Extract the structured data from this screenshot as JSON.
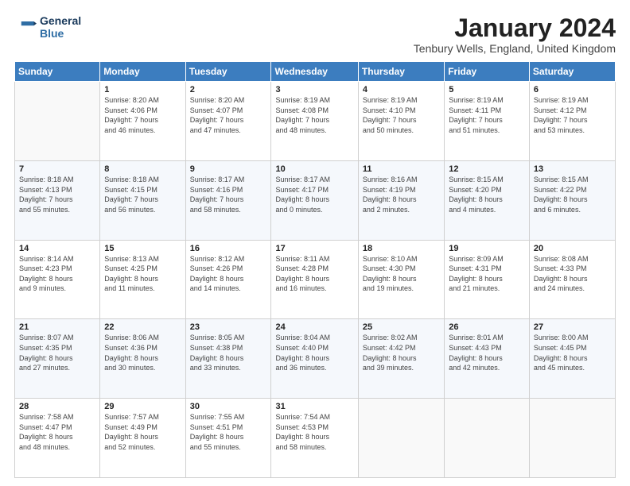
{
  "logo": {
    "line1": "General",
    "line2": "Blue"
  },
  "title": "January 2024",
  "location": "Tenbury Wells, England, United Kingdom",
  "days_header": [
    "Sunday",
    "Monday",
    "Tuesday",
    "Wednesday",
    "Thursday",
    "Friday",
    "Saturday"
  ],
  "weeks": [
    [
      {
        "day": "",
        "detail": ""
      },
      {
        "day": "1",
        "detail": "Sunrise: 8:20 AM\nSunset: 4:06 PM\nDaylight: 7 hours\nand 46 minutes."
      },
      {
        "day": "2",
        "detail": "Sunrise: 8:20 AM\nSunset: 4:07 PM\nDaylight: 7 hours\nand 47 minutes."
      },
      {
        "day": "3",
        "detail": "Sunrise: 8:19 AM\nSunset: 4:08 PM\nDaylight: 7 hours\nand 48 minutes."
      },
      {
        "day": "4",
        "detail": "Sunrise: 8:19 AM\nSunset: 4:10 PM\nDaylight: 7 hours\nand 50 minutes."
      },
      {
        "day": "5",
        "detail": "Sunrise: 8:19 AM\nSunset: 4:11 PM\nDaylight: 7 hours\nand 51 minutes."
      },
      {
        "day": "6",
        "detail": "Sunrise: 8:19 AM\nSunset: 4:12 PM\nDaylight: 7 hours\nand 53 minutes."
      }
    ],
    [
      {
        "day": "7",
        "detail": "Sunrise: 8:18 AM\nSunset: 4:13 PM\nDaylight: 7 hours\nand 55 minutes."
      },
      {
        "day": "8",
        "detail": "Sunrise: 8:18 AM\nSunset: 4:15 PM\nDaylight: 7 hours\nand 56 minutes."
      },
      {
        "day": "9",
        "detail": "Sunrise: 8:17 AM\nSunset: 4:16 PM\nDaylight: 7 hours\nand 58 minutes."
      },
      {
        "day": "10",
        "detail": "Sunrise: 8:17 AM\nSunset: 4:17 PM\nDaylight: 8 hours\nand 0 minutes."
      },
      {
        "day": "11",
        "detail": "Sunrise: 8:16 AM\nSunset: 4:19 PM\nDaylight: 8 hours\nand 2 minutes."
      },
      {
        "day": "12",
        "detail": "Sunrise: 8:15 AM\nSunset: 4:20 PM\nDaylight: 8 hours\nand 4 minutes."
      },
      {
        "day": "13",
        "detail": "Sunrise: 8:15 AM\nSunset: 4:22 PM\nDaylight: 8 hours\nand 6 minutes."
      }
    ],
    [
      {
        "day": "14",
        "detail": "Sunrise: 8:14 AM\nSunset: 4:23 PM\nDaylight: 8 hours\nand 9 minutes."
      },
      {
        "day": "15",
        "detail": "Sunrise: 8:13 AM\nSunset: 4:25 PM\nDaylight: 8 hours\nand 11 minutes."
      },
      {
        "day": "16",
        "detail": "Sunrise: 8:12 AM\nSunset: 4:26 PM\nDaylight: 8 hours\nand 14 minutes."
      },
      {
        "day": "17",
        "detail": "Sunrise: 8:11 AM\nSunset: 4:28 PM\nDaylight: 8 hours\nand 16 minutes."
      },
      {
        "day": "18",
        "detail": "Sunrise: 8:10 AM\nSunset: 4:30 PM\nDaylight: 8 hours\nand 19 minutes."
      },
      {
        "day": "19",
        "detail": "Sunrise: 8:09 AM\nSunset: 4:31 PM\nDaylight: 8 hours\nand 21 minutes."
      },
      {
        "day": "20",
        "detail": "Sunrise: 8:08 AM\nSunset: 4:33 PM\nDaylight: 8 hours\nand 24 minutes."
      }
    ],
    [
      {
        "day": "21",
        "detail": "Sunrise: 8:07 AM\nSunset: 4:35 PM\nDaylight: 8 hours\nand 27 minutes."
      },
      {
        "day": "22",
        "detail": "Sunrise: 8:06 AM\nSunset: 4:36 PM\nDaylight: 8 hours\nand 30 minutes."
      },
      {
        "day": "23",
        "detail": "Sunrise: 8:05 AM\nSunset: 4:38 PM\nDaylight: 8 hours\nand 33 minutes."
      },
      {
        "day": "24",
        "detail": "Sunrise: 8:04 AM\nSunset: 4:40 PM\nDaylight: 8 hours\nand 36 minutes."
      },
      {
        "day": "25",
        "detail": "Sunrise: 8:02 AM\nSunset: 4:42 PM\nDaylight: 8 hours\nand 39 minutes."
      },
      {
        "day": "26",
        "detail": "Sunrise: 8:01 AM\nSunset: 4:43 PM\nDaylight: 8 hours\nand 42 minutes."
      },
      {
        "day": "27",
        "detail": "Sunrise: 8:00 AM\nSunset: 4:45 PM\nDaylight: 8 hours\nand 45 minutes."
      }
    ],
    [
      {
        "day": "28",
        "detail": "Sunrise: 7:58 AM\nSunset: 4:47 PM\nDaylight: 8 hours\nand 48 minutes."
      },
      {
        "day": "29",
        "detail": "Sunrise: 7:57 AM\nSunset: 4:49 PM\nDaylight: 8 hours\nand 52 minutes."
      },
      {
        "day": "30",
        "detail": "Sunrise: 7:55 AM\nSunset: 4:51 PM\nDaylight: 8 hours\nand 55 minutes."
      },
      {
        "day": "31",
        "detail": "Sunrise: 7:54 AM\nSunset: 4:53 PM\nDaylight: 8 hours\nand 58 minutes."
      },
      {
        "day": "",
        "detail": ""
      },
      {
        "day": "",
        "detail": ""
      },
      {
        "day": "",
        "detail": ""
      }
    ]
  ]
}
